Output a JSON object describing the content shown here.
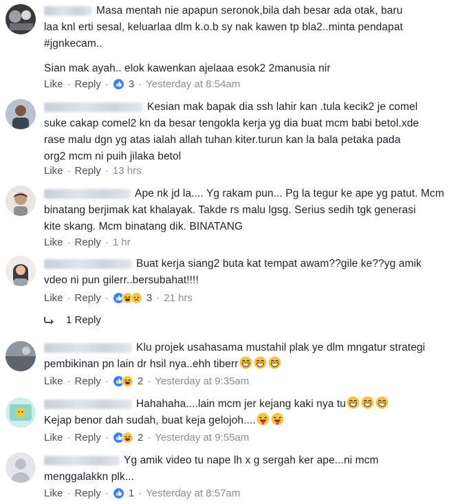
{
  "comments": [
    {
      "text_lines": [
        "Masa mentah nie apapun seronok,bila dah besar ada otak, baru",
        "laa knl erti sesal, keluarlaa dlm k.o.b sy nak kawen tp bla2..minta pendapat",
        "#jgnkecam..",
        "",
        "Sian mak ayah.. elok kawenkan ajelaaa esok2 2manusia nir"
      ],
      "like": "Like",
      "reply": "Reply",
      "reaction_count": "3",
      "time": "Yesterday at 8:54am",
      "reactions": [
        "like-icon"
      ]
    },
    {
      "text_lines": [
        "Kesian mak bapak dia ssh lahir kan .tula kecik2 je comel",
        "suke cakap comel2 kn da besar tengokla kerja yg dia buat mcm babi betol.xde",
        "rase malu dgn yg atas ialah allah tuhan kiter.turun kan la bala petaka pada",
        "org2 mcm ni puih jilaka betol"
      ],
      "like": "Like",
      "reply": "Reply",
      "reaction_count": "",
      "time": "13 hrs",
      "reactions": []
    },
    {
      "text_lines": [
        "Ape nk jd la.... Yg rakam pun... Pg la tegur ke ape yg patut. Mcm",
        "binatang berjimak kat khalayak. Takde rs malu lgsg. Serius sedih tgk generasi",
        "kite skang. Mcm binatang dik. BINATANG"
      ],
      "like": "Like",
      "reply": "Reply",
      "reaction_count": "",
      "time": "1 hr",
      "reactions": []
    },
    {
      "text_lines": [
        "Buat kerja siang2 buta kat tempat awam??gile ke??yg amik",
        "vdeo ni pun gilerr..bersubahat!!!!"
      ],
      "like": "Like",
      "reply": "Reply",
      "reaction_count": "3",
      "time": "21 hrs",
      "reactions": [
        "like-icon",
        "haha-icon",
        "sad-icon"
      ],
      "replies_label": "1 Reply"
    },
    {
      "text_lines": [
        "Klu projek usahasama mustahil plak ye dlm mngatur strategi",
        "pembikinan pn lain dr hsil nya..ehh tiberr"
      ],
      "like": "Like",
      "reply": "Reply",
      "reaction_count": "2",
      "time": "Yesterday at 9:35am",
      "reactions": [
        "like-icon",
        "haha-icon"
      ]
    },
    {
      "text_lines": [
        "Hahahaha....lain mcm jer kejang kaki nya tu",
        "Kejap benor dah sudah, buat keja gelojoh...."
      ],
      "like": "Like",
      "reply": "Reply",
      "reaction_count": "2",
      "time": "Yesterday at 9:55am",
      "reactions": [
        "like-icon",
        "haha-icon"
      ]
    },
    {
      "text_lines": [
        "Yg amik video tu nape lh x g sergah ker ape...ni mcm",
        "menggalakkn plk..."
      ],
      "like": "Like",
      "reply": "Reply",
      "reaction_count": "1",
      "time": "Yesterday at 8:57am",
      "reactions": [
        "like-icon"
      ]
    }
  ],
  "colors": {
    "like_blue": "#4080ff",
    "haha_yellow": "#f7c545",
    "meta_gray": "#8a8d91",
    "text": "#1d2129"
  }
}
